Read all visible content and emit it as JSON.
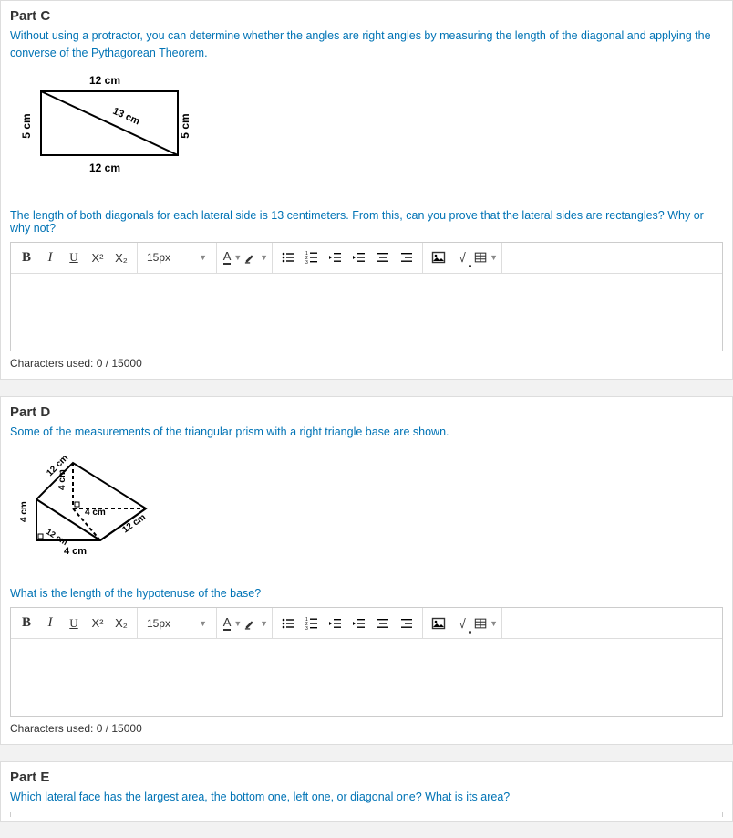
{
  "parts": {
    "c": {
      "title": "Part C",
      "desc": "Without using a protractor, you can determine whether the angles are right angles by measuring the length of the diagonal and applying the converse of the Pythagorean Theorem.",
      "question": "The length of both diagonals for each lateral side is 13 centimeters. From this, can you prove that the lateral sides are rectangles? Why or why not?",
      "figure": {
        "top": "12 cm",
        "bottom": "12 cm",
        "left": "5 cm",
        "right": "5 cm",
        "diagonal": "13 cm"
      },
      "char_count": "Characters used: 0 / 15000"
    },
    "d": {
      "title": "Part D",
      "desc": "Some of the measurements of the triangular prism with a right triangle base are shown.",
      "question": "What is the length of the hypotenuse of the base?",
      "figure": {
        "top_left": "12 cm",
        "left": "4 cm",
        "height": "4 cm",
        "inner_base": "4 cm",
        "bottom": "4 cm",
        "right": "12 cm",
        "inner_left": "12 cm"
      },
      "char_count": "Characters used: 0 / 15000"
    },
    "e": {
      "title": "Part E",
      "desc": "Which lateral face has the largest area, the bottom one, left one, or diagonal one? What is its area?"
    }
  },
  "toolbar": {
    "bold": "B",
    "italic": "I",
    "underline": "U",
    "sup": "X²",
    "sub": "X₂",
    "fontsize": "15px",
    "fontcolor": "A",
    "math": "√"
  }
}
